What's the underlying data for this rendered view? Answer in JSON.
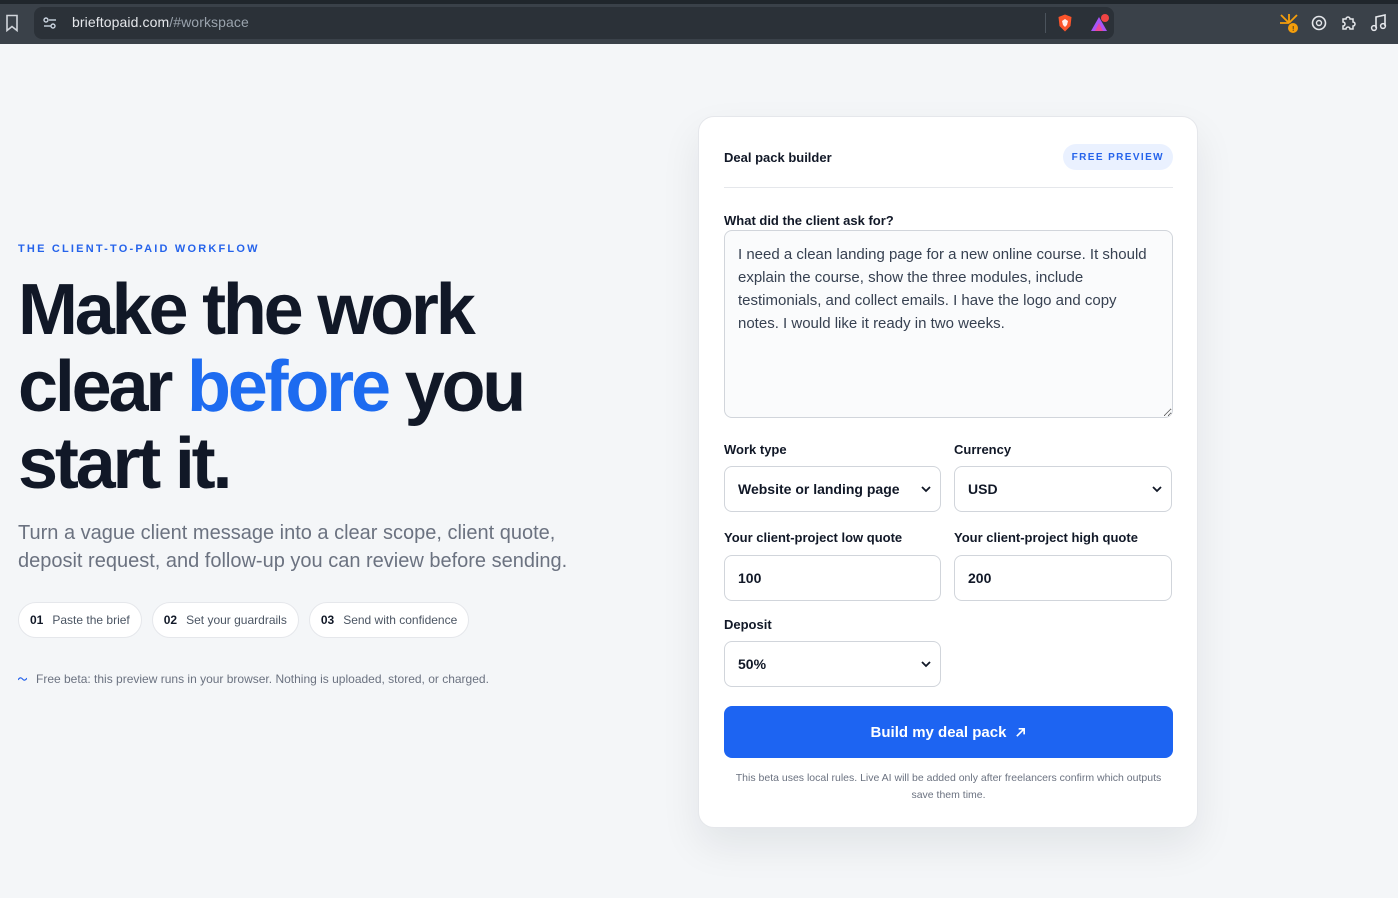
{
  "browser": {
    "url_host": "brieftopaid.com",
    "url_path": "/#workspace",
    "colors": {
      "brave_orange": "#fb542b",
      "chrome_bg": "#3a4149"
    }
  },
  "hero": {
    "eyebrow": "THE CLIENT-TO-PAID WORKFLOW",
    "headline_line1": "Make the work",
    "headline_clear": "clear ",
    "headline_accent": "before",
    "headline_you": " you",
    "headline_line3": "start it.",
    "subcopy": "Turn a vague client message into a clear scope, client quote, deposit request, and follow-up you can review before sending.",
    "steps": [
      {
        "num": "01",
        "label": "Paste the brief"
      },
      {
        "num": "02",
        "label": "Set your guardrails"
      },
      {
        "num": "03",
        "label": "Send with confidence"
      }
    ],
    "beta_note": "Free beta: this preview runs in your browser. Nothing is uploaded, stored, or charged.",
    "accent_color": "#1d6bf0"
  },
  "builder": {
    "title": "Deal pack builder",
    "badge": "FREE PREVIEW",
    "brief_label": "What did the client ask for?",
    "brief_value": "I need a clean landing page for a new online course. It should explain the course, show the three modules, include testimonials, and collect emails. I have the logo and copy notes. I would like it ready in two weeks.",
    "work_type_label": "Work type",
    "work_type_value": "Website or landing page",
    "currency_label": "Currency",
    "currency_value": "USD",
    "low_quote_label": "Your client-project low quote",
    "low_quote_value": "100",
    "high_quote_label": "Your client-project high quote",
    "high_quote_value": "200",
    "deposit_label": "Deposit",
    "deposit_value": "50%",
    "build_button": "Build my deal pack",
    "build_icon": "arrow-up-right-icon",
    "footnote": "This beta uses local rules. Live AI will be added only after freelancers confirm which outputs save them time.",
    "button_color": "#1d64f2"
  }
}
